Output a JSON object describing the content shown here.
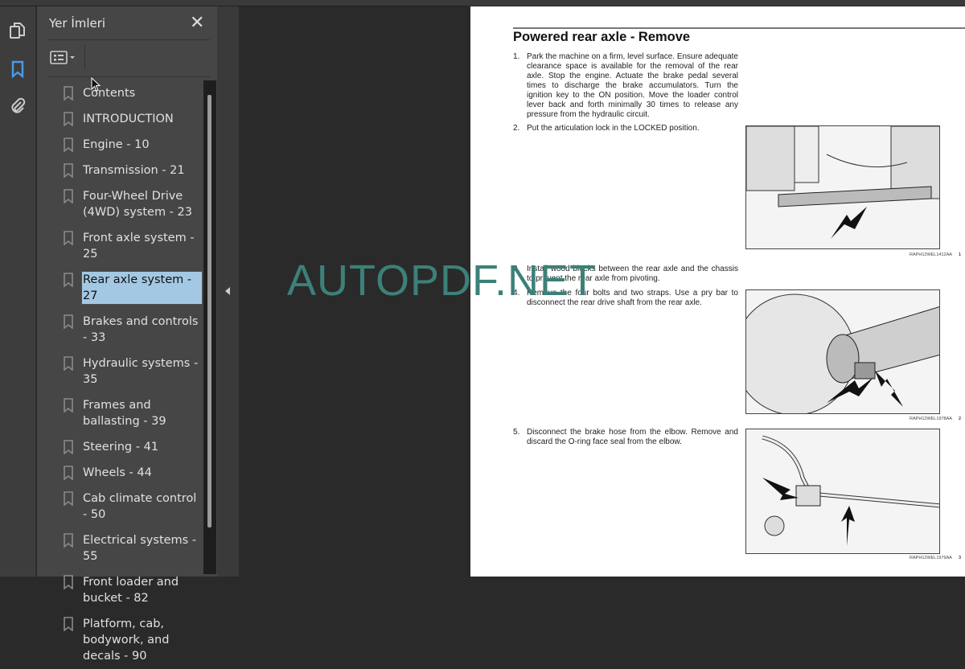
{
  "sidebar_panel": {
    "title": "Yer İmleri",
    "close_icon": "close-icon",
    "options_icon": "list-options-icon",
    "items": [
      {
        "label": "Contents"
      },
      {
        "label": "INTRODUCTION"
      },
      {
        "label": "Engine - 10"
      },
      {
        "label": "Transmission - 21"
      },
      {
        "label": "Four-Wheel Drive (4WD) system - 23"
      },
      {
        "label": "Front axle system - 25"
      },
      {
        "label": "Rear axle system - 27",
        "selected": true
      },
      {
        "label": "Brakes and controls - 33"
      },
      {
        "label": "Hydraulic systems - 35"
      },
      {
        "label": "Frames and ballasting - 39"
      },
      {
        "label": "Steering - 41"
      },
      {
        "label": "Wheels - 44"
      },
      {
        "label": "Cab climate control - 50"
      },
      {
        "label": "Electrical systems - 55"
      },
      {
        "label": "Front loader and bucket - 82"
      },
      {
        "label": "Platform, cab, bodywork, and decals - 90"
      }
    ]
  },
  "rail_icons": [
    "pages-icon",
    "bookmark-icon",
    "attachment-icon"
  ],
  "colors": {
    "accent": "#4a9be8",
    "selection": "#a3c8e3",
    "watermark": "#3d8078"
  },
  "document": {
    "heading": "Powered rear axle - Remove",
    "steps": [
      {
        "n": "1.",
        "text": "Park the machine on a firm, level surface. Ensure adequate clearance space is available for the removal of the rear axle. Stop the engine. Actuate the brake pedal several times to discharge the brake accumulators. Turn the ignition key to the ON position. Move the loader control lever back and forth minimally 30 times to release any pressure from the hydraulic circuit."
      },
      {
        "n": "2.",
        "text": "Put the articulation lock in the LOCKED position."
      },
      {
        "n": "3.",
        "text": "Install wood blocks between the rear axle and the chassis to prevent the rear axle from pivoting."
      },
      {
        "n": "4.",
        "text": "Remove the four bolts and two straps. Use a pry bar to disconnect the rear drive shaft from the rear axle."
      },
      {
        "n": "5.",
        "text": "Disconnect the brake hose from the elbow. Remove and discard the O-ring face seal from the elbow."
      }
    ],
    "figures": [
      {
        "code": "RAPH12WEL1412AA",
        "num": "1"
      },
      {
        "code": "RAPH12WEL1978AA",
        "num": "2"
      },
      {
        "code": "RAPH12WEL1979AA",
        "num": "3"
      }
    ]
  },
  "watermark": "AUTOPDF.NET"
}
